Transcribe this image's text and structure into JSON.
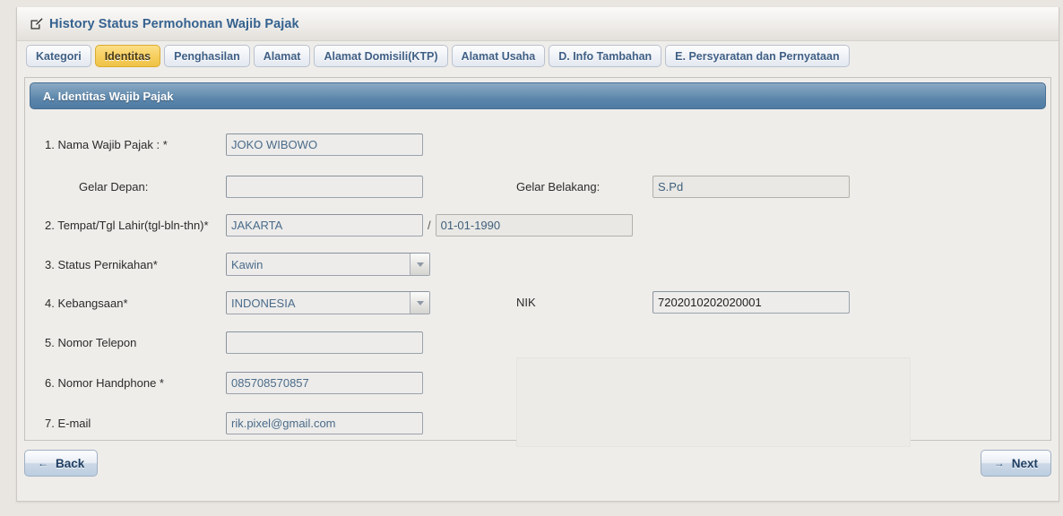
{
  "window": {
    "title": "History Status Permohonan Wajib Pajak",
    "title_icon": "edit-square-icon",
    "accent_color": "#35628f",
    "section_bar_color": "#5c86ab",
    "active_tab_color": "#f6ce5d"
  },
  "tabs": [
    {
      "label": "Kategori",
      "active": false
    },
    {
      "label": "Identitas",
      "active": true
    },
    {
      "label": "Penghasilan",
      "active": false
    },
    {
      "label": "Alamat",
      "active": false
    },
    {
      "label": "Alamat Domisili(KTP)",
      "active": false
    },
    {
      "label": "Alamat Usaha",
      "active": false
    },
    {
      "label": "D. Info Tambahan",
      "active": false
    },
    {
      "label": "E. Persyaratan dan Pernyataan",
      "active": false
    }
  ],
  "section": {
    "heading": "A. Identitas Wajib Pajak"
  },
  "form": {
    "nama": {
      "label": "1. Nama Wajib Pajak : *",
      "value": "JOKO WIBOWO",
      "placeholder": ""
    },
    "gelar_depan": {
      "label": "Gelar Depan:",
      "value": "",
      "placeholder": ""
    },
    "gelar_belakang": {
      "label": "Gelar Belakang:",
      "value": "S.Pd",
      "placeholder": ""
    },
    "tempat_tgl_lahir": {
      "label": "2. Tempat/Tgl Lahir(tgl-bln-thn)*",
      "tempat_value": "JAKARTA",
      "separator": "/",
      "tanggal_value": "01-01-1990",
      "placeholder": ""
    },
    "status_pernikahan": {
      "label": "3. Status Pernikahan*",
      "value": "Kawin",
      "icon": "chevron-down-icon"
    },
    "kebangsaan": {
      "label": "4. Kebangsaan*",
      "value": "INDONESIA",
      "icon": "chevron-down-icon"
    },
    "nik": {
      "label": "NIK",
      "value": "7202010202020001",
      "placeholder": ""
    },
    "nomor_telepon": {
      "label": "5. Nomor Telepon",
      "value": "",
      "placeholder": ""
    },
    "nomor_handphone": {
      "label": "6. Nomor Handphone *",
      "value": "085708570857",
      "placeholder": ""
    },
    "email": {
      "label": "7. E-mail",
      "value": "rik.pixel@gmail.com",
      "placeholder": ""
    }
  },
  "footer": {
    "back": {
      "label": "Back",
      "icon": "arrow-left-icon",
      "glyph": "←"
    },
    "next": {
      "label": "Next",
      "icon": "arrow-right-icon",
      "glyph": "→"
    }
  }
}
